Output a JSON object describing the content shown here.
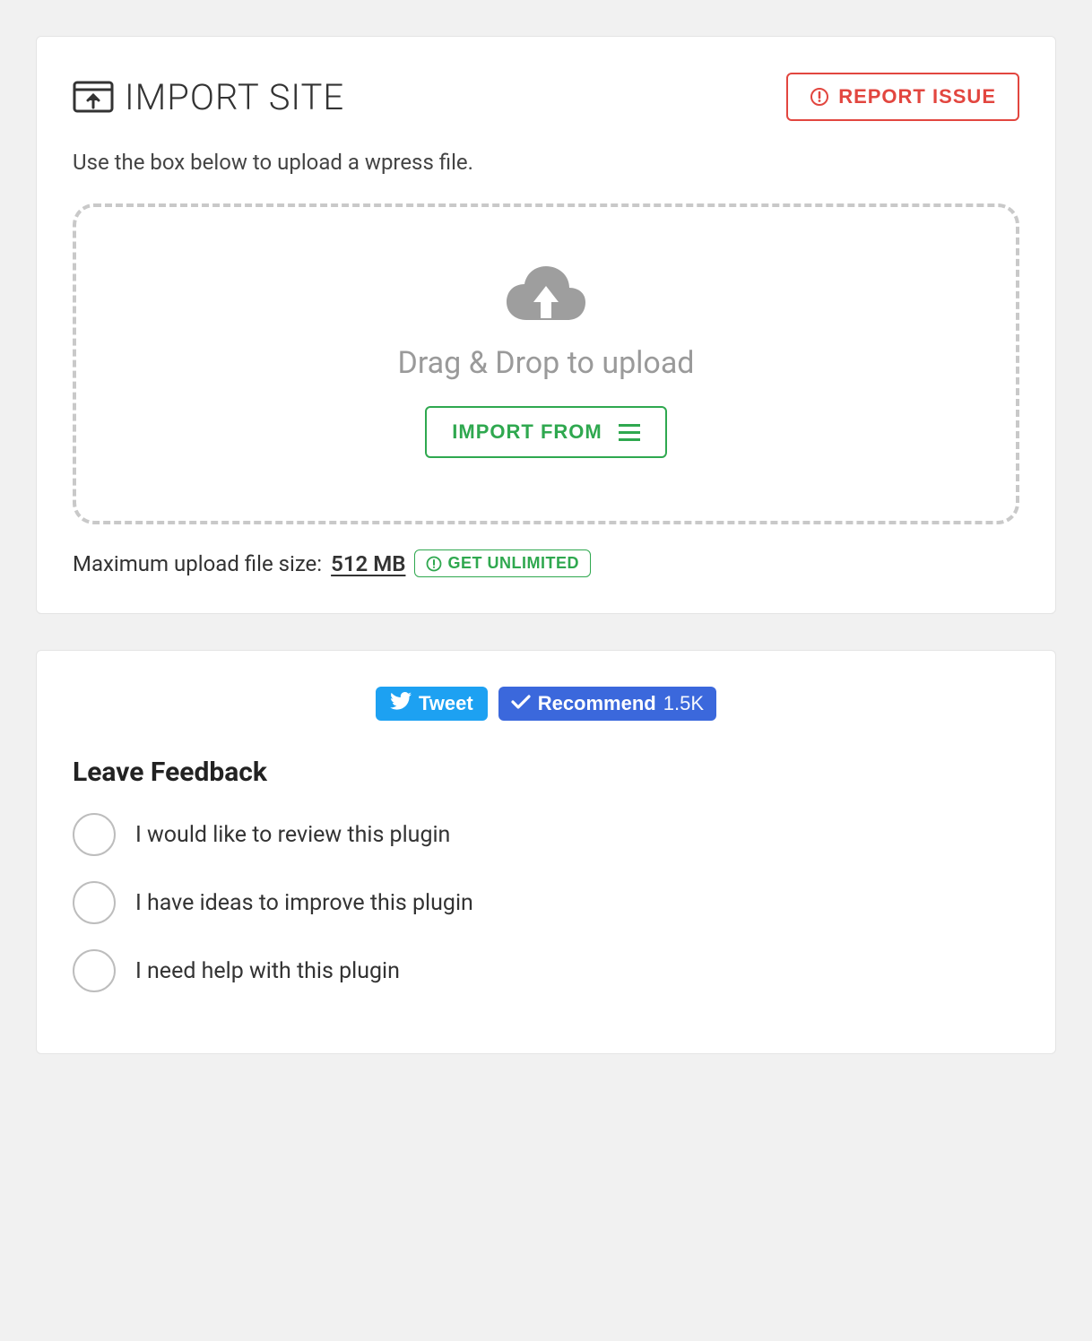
{
  "import": {
    "title": "IMPORT SITE",
    "report_label": "REPORT ISSUE",
    "subtitle": "Use the box below to upload a wpress file.",
    "drop_text": "Drag & Drop to upload",
    "import_from_label": "IMPORT FROM",
    "max_size_label": "Maximum upload file size:",
    "max_size_value": "512 MB",
    "unlimited_label": "GET UNLIMITED"
  },
  "social": {
    "tweet_label": "Tweet",
    "recommend_label": "Recommend",
    "recommend_count": "1.5K"
  },
  "feedback": {
    "title": "Leave Feedback",
    "options": [
      "I would like to review this plugin",
      "I have ideas to improve this plugin",
      "I need help with this plugin"
    ]
  },
  "colors": {
    "green": "#2fa84f",
    "red": "#e2463f",
    "twitter": "#1da1f2",
    "facebook": "#3b68dc"
  }
}
